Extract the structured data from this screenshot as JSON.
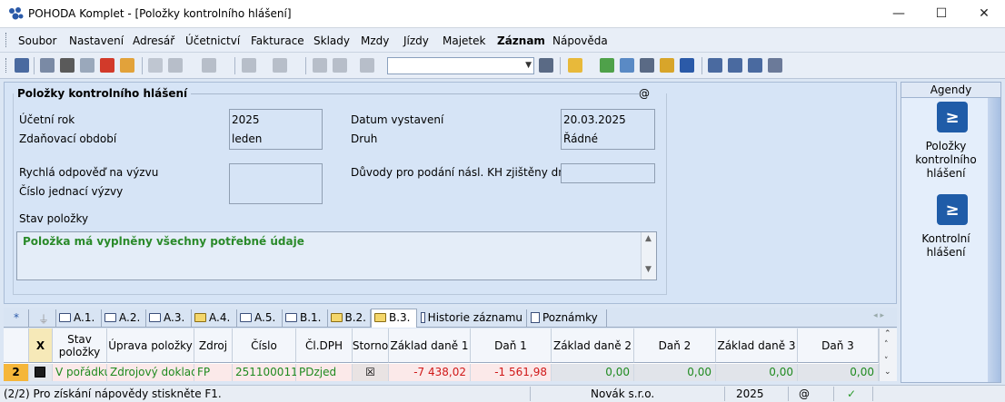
{
  "window": {
    "title": "POHODA Komplet - [Položky kontrolního hlášení]",
    "minimize": "—",
    "maximize": "☐",
    "close": "✕"
  },
  "menu": [
    "Soubor",
    "Nastavení",
    "Adresář",
    "Účetnictví",
    "Fakturace",
    "Sklady",
    "Mzdy",
    "Jízdy",
    "Majetek",
    "Záznam",
    "Nápověda"
  ],
  "toolbar": {
    "filter_value": ""
  },
  "section": {
    "title": "Položky kontrolního hlášení",
    "at": "@"
  },
  "form": {
    "ucetni_rok_label": "Účetní rok",
    "ucetni_rok": "2025",
    "zdanovaci_obdobi_label": "Zdaňovací období",
    "zdanovaci_obdobi": "leden",
    "datum_vystaveni_label": "Datum vystavení",
    "datum_vystaveni": "20.03.2025",
    "druh_label": "Druh",
    "druh": "Řádné",
    "rychla_odpoved_label": "Rychlá odpověď na výzvu",
    "cislo_jednaci_label": "Číslo jednací výzvy",
    "duvody_label": "Důvody pro podání násl. KH zjištěny dne",
    "stav_polozky_label": "Stav položky",
    "stav_text": "Položka má vyplněny všechny potřebné údaje"
  },
  "tabs": {
    "star": "*",
    "items": [
      "A.1.",
      "A.2.",
      "A.3.",
      "A.4.",
      "A.5.",
      "B.1.",
      "B.2.",
      "B.3."
    ],
    "historie": "Historie záznamu",
    "poznamky": "Poznámky"
  },
  "grid": {
    "headers": {
      "x": "X",
      "stav": "Stav položky",
      "uprava": "Úprava položky",
      "zdroj": "Zdroj",
      "cislo": "Číslo",
      "cl_dph": "Čl.DPH",
      "storno": "Storno",
      "zaklad1": "Základ daně 1",
      "dan1": "Daň 1",
      "zaklad2": "Základ daně 2",
      "dan2": "Daň 2",
      "zaklad3": "Základ daně 3",
      "dan3": "Daň 3"
    },
    "row": {
      "num": "2",
      "stav": "V pořádku",
      "uprava": "Zdrojový doklad",
      "zdroj": "FP",
      "cislo": "251100011",
      "cl_dph": "PDzjed",
      "storno": "☒",
      "zaklad1": "-7 438,02",
      "dan1": "-1 561,98",
      "zaklad2": "0,00",
      "dan2": "0,00",
      "zaklad3": "0,00",
      "dan3": "0,00"
    }
  },
  "agendy": {
    "title": "Agendy",
    "item1": "Položky kontrolního hlášení",
    "item2": "Kontrolní hlášení"
  },
  "statusbar": {
    "help": "(2/2) Pro získání nápovědy stiskněte F1.",
    "company": "Novák s.r.o.",
    "year": "2025",
    "at": "@",
    "check": "✓"
  }
}
